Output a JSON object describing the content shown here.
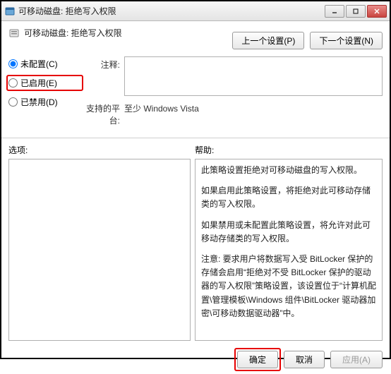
{
  "window": {
    "title": "可移动磁盘: 拒绝写入权限"
  },
  "heading": "可移动磁盘: 拒绝写入权限",
  "nav": {
    "prev": "上一个设置(P)",
    "next": "下一个设置(N)"
  },
  "radios": {
    "not_configured": "未配置(C)",
    "enabled": "已启用(E)",
    "disabled": "已禁用(D)",
    "selected": "not_configured"
  },
  "fields": {
    "comment_label": "注释:",
    "comment_value": "",
    "platform_label": "支持的平台:",
    "platform_value": "至少 Windows Vista"
  },
  "lower_labels": {
    "options": "选项:",
    "help": "帮助:"
  },
  "help_paragraphs": [
    "此策略设置拒绝对可移动磁盘的写入权限。",
    "如果启用此策略设置，将拒绝对此可移动存储类的写入权限。",
    "如果禁用或未配置此策略设置，将允许对此可移动存储类的写入权限。",
    "注意: 要求用户将数据写入受 BitLocker 保护的存储会启用“拒绝对不受 BitLocker 保护的驱动器的写入权限”策略设置，该设置位于“计算机配置\\管理模板\\Windows 组件\\BitLocker 驱动器加密\\可移动数据驱动器”中。"
  ],
  "buttons": {
    "ok": "确定",
    "cancel": "取消",
    "apply": "应用(A)"
  }
}
